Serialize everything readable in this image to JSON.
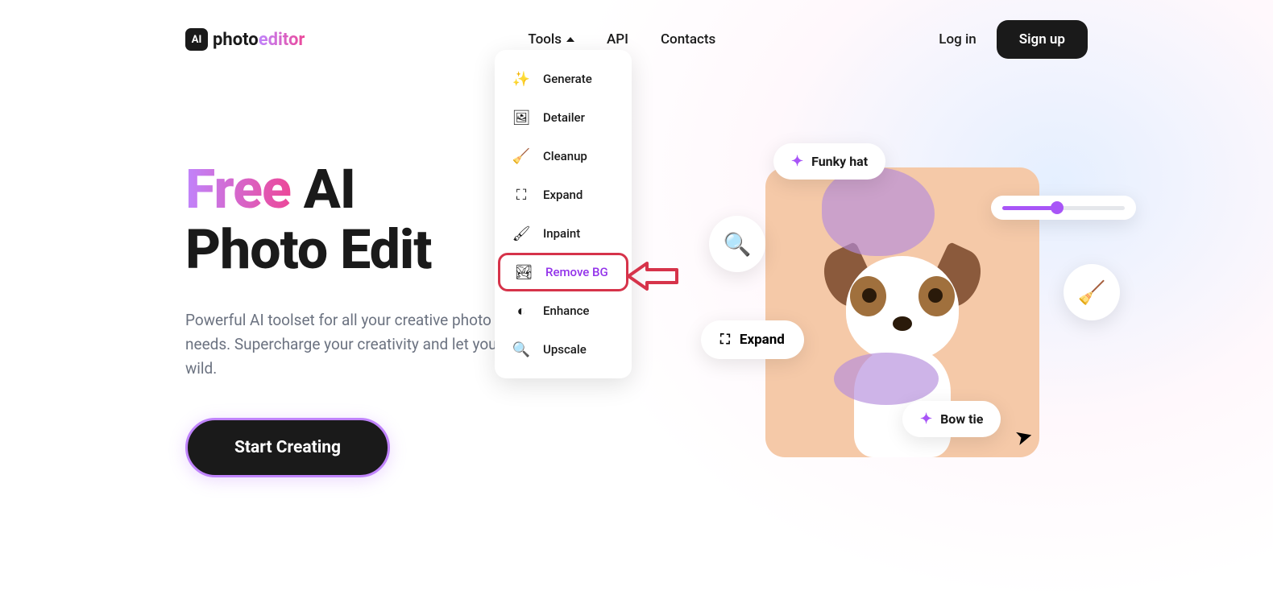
{
  "logo": {
    "badge": "AI",
    "part1": "photo",
    "part2": "editor"
  },
  "nav": {
    "tools": "Tools",
    "api": "API",
    "contacts": "Contacts"
  },
  "auth": {
    "login": "Log in",
    "signup": "Sign up"
  },
  "dropdown": {
    "items": [
      {
        "label": "Generate",
        "icon": "✨"
      },
      {
        "label": "Detailer",
        "icon": "🖼"
      },
      {
        "label": "Cleanup",
        "icon": "🧹"
      },
      {
        "label": "Expand",
        "icon": "⛶"
      },
      {
        "label": "Inpaint",
        "icon": "🖌"
      },
      {
        "label": "Remove BG",
        "icon": "🏞",
        "highlighted": true
      },
      {
        "label": "Enhance",
        "icon": "◐"
      },
      {
        "label": "Upscale",
        "icon": "🔍"
      }
    ]
  },
  "hero": {
    "title_free": "Free",
    "title_rest1": " AI",
    "title_rest2": "Photo Edit",
    "description": "Powerful AI toolset for all your creative photo and design editing needs. Supercharge your creativity and let your imagination run wild.",
    "cta": "Start Creating"
  },
  "widgets": {
    "funky_hat": "Funky hat",
    "bow_tie": "Bow tie",
    "expand": "Expand"
  }
}
